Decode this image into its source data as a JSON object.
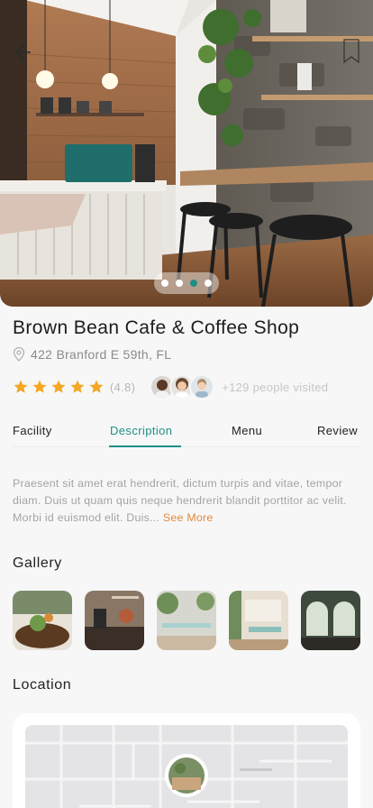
{
  "cafe": {
    "name": "Brown Bean Cafe & Coffee Shop",
    "address": "422 Branford E 59th, FL",
    "rating_value": "(4.8)",
    "stars_filled": 5,
    "visited_text": "+129 people visited"
  },
  "hero": {
    "slides_count": 4,
    "active_slide": 3
  },
  "tabs": [
    {
      "label": "Facility"
    },
    {
      "label": "Description"
    },
    {
      "label": "Menu"
    },
    {
      "label": "Review"
    }
  ],
  "active_tab": "Description",
  "description": {
    "text": "Praesent sit amet erat hendrerit, dictum turpis and vitae, tempor diam. Duis ut quam quis neque hendrerit blandit porttitor ac velit. Morbi id euismod elit. Duis...",
    "see_more": "See More"
  },
  "gallery": {
    "title": "Gallery",
    "items": [
      "photo-1",
      "photo-2",
      "photo-3",
      "photo-4",
      "photo-5"
    ]
  },
  "location": {
    "title": "Location"
  },
  "colors": {
    "accent": "#1f8f86",
    "star": "#f5a623",
    "link": "#e3893a"
  },
  "icons": [
    "back-arrow-icon",
    "bookmark-icon",
    "location-pin-icon",
    "star-icon"
  ]
}
